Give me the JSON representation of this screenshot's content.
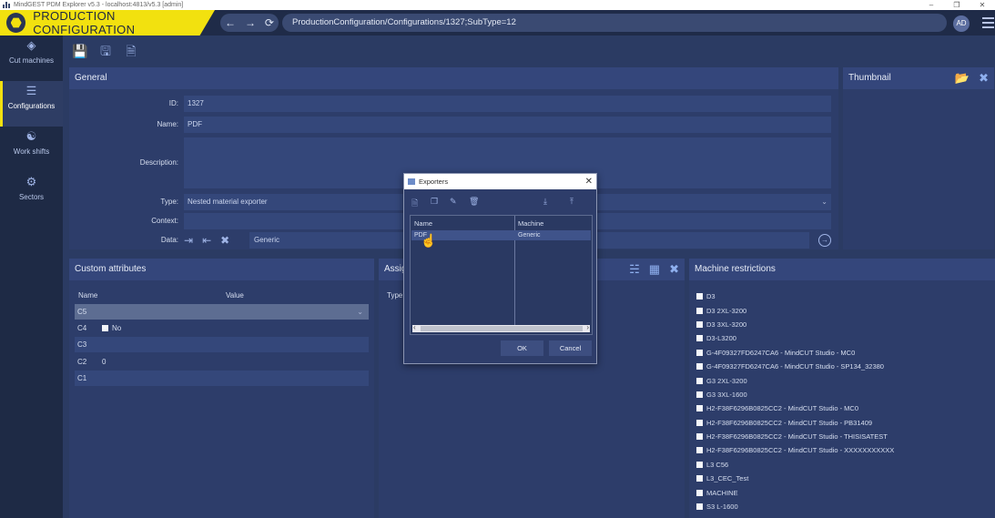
{
  "window": {
    "title": "MindGEST PDM Explorer v5.3 - localhost:4813/v5.3 [admin]"
  },
  "header": {
    "title": "PRODUCTION CONFIGURATION",
    "url": "ProductionConfiguration/Configurations/1327;SubType=12",
    "user_initials": "AD"
  },
  "sidebar": {
    "items": [
      {
        "label": "Cut machines",
        "icon": "cut-machine-icon"
      },
      {
        "label": "Configurations",
        "icon": "configurations-icon"
      },
      {
        "label": "Work shifts",
        "icon": "work-shifts-icon"
      },
      {
        "label": "Sectors",
        "icon": "sectors-icon"
      }
    ]
  },
  "general": {
    "title": "General",
    "id_label": "ID:",
    "id_value": "1327",
    "name_label": "Name:",
    "name_value": "PDF",
    "description_label": "Description:",
    "description_value": "",
    "type_label": "Type:",
    "type_value": "Nested material exporter",
    "context_label": "Context:",
    "context_value": "",
    "data_label": "Data:",
    "data_value": "Generic"
  },
  "thumbnail": {
    "title": "Thumbnail"
  },
  "custom_attributes": {
    "title": "Custom attributes",
    "col_name": "Name",
    "col_value": "Value",
    "rows": [
      {
        "name": "C5",
        "value": ""
      },
      {
        "name": "C4",
        "value": "No"
      },
      {
        "name": "C3",
        "value": ""
      },
      {
        "name": "C2",
        "value": "0"
      },
      {
        "name": "C1",
        "value": ""
      }
    ]
  },
  "assign": {
    "title": "Assig",
    "type_label": "Type"
  },
  "machine_restrictions": {
    "title": "Machine restrictions",
    "items": [
      "D3",
      "D3 2XL-3200",
      "D3 3XL-3200",
      "D3-L3200",
      "G-4F09327FD6247CA6 - MindCUT Studio - MC0",
      "G-4F09327FD6247CA6 - MindCUT Studio - SP134_32380",
      "G3 2XL-3200",
      "G3 3XL-1600",
      "H2-F38F6296B0825CC2 - MindCUT Studio - MC0",
      "H2-F38F6296B0825CC2 - MindCUT Studio - PB31409",
      "H2-F38F6296B0825CC2 - MindCUT Studio - THISISATEST",
      "H2-F38F6296B0825CC2 - MindCUT Studio - XXXXXXXXXXX",
      "L3 C56",
      "L3_CEC_Test",
      "MACHINE",
      "S3 L-1600"
    ]
  },
  "dialog": {
    "title": "Exporters",
    "col_name": "Name",
    "col_machine": "Machine",
    "rows": [
      {
        "name": "PDF",
        "machine": "Generic"
      }
    ],
    "ok_label": "OK",
    "cancel_label": "Cancel"
  }
}
